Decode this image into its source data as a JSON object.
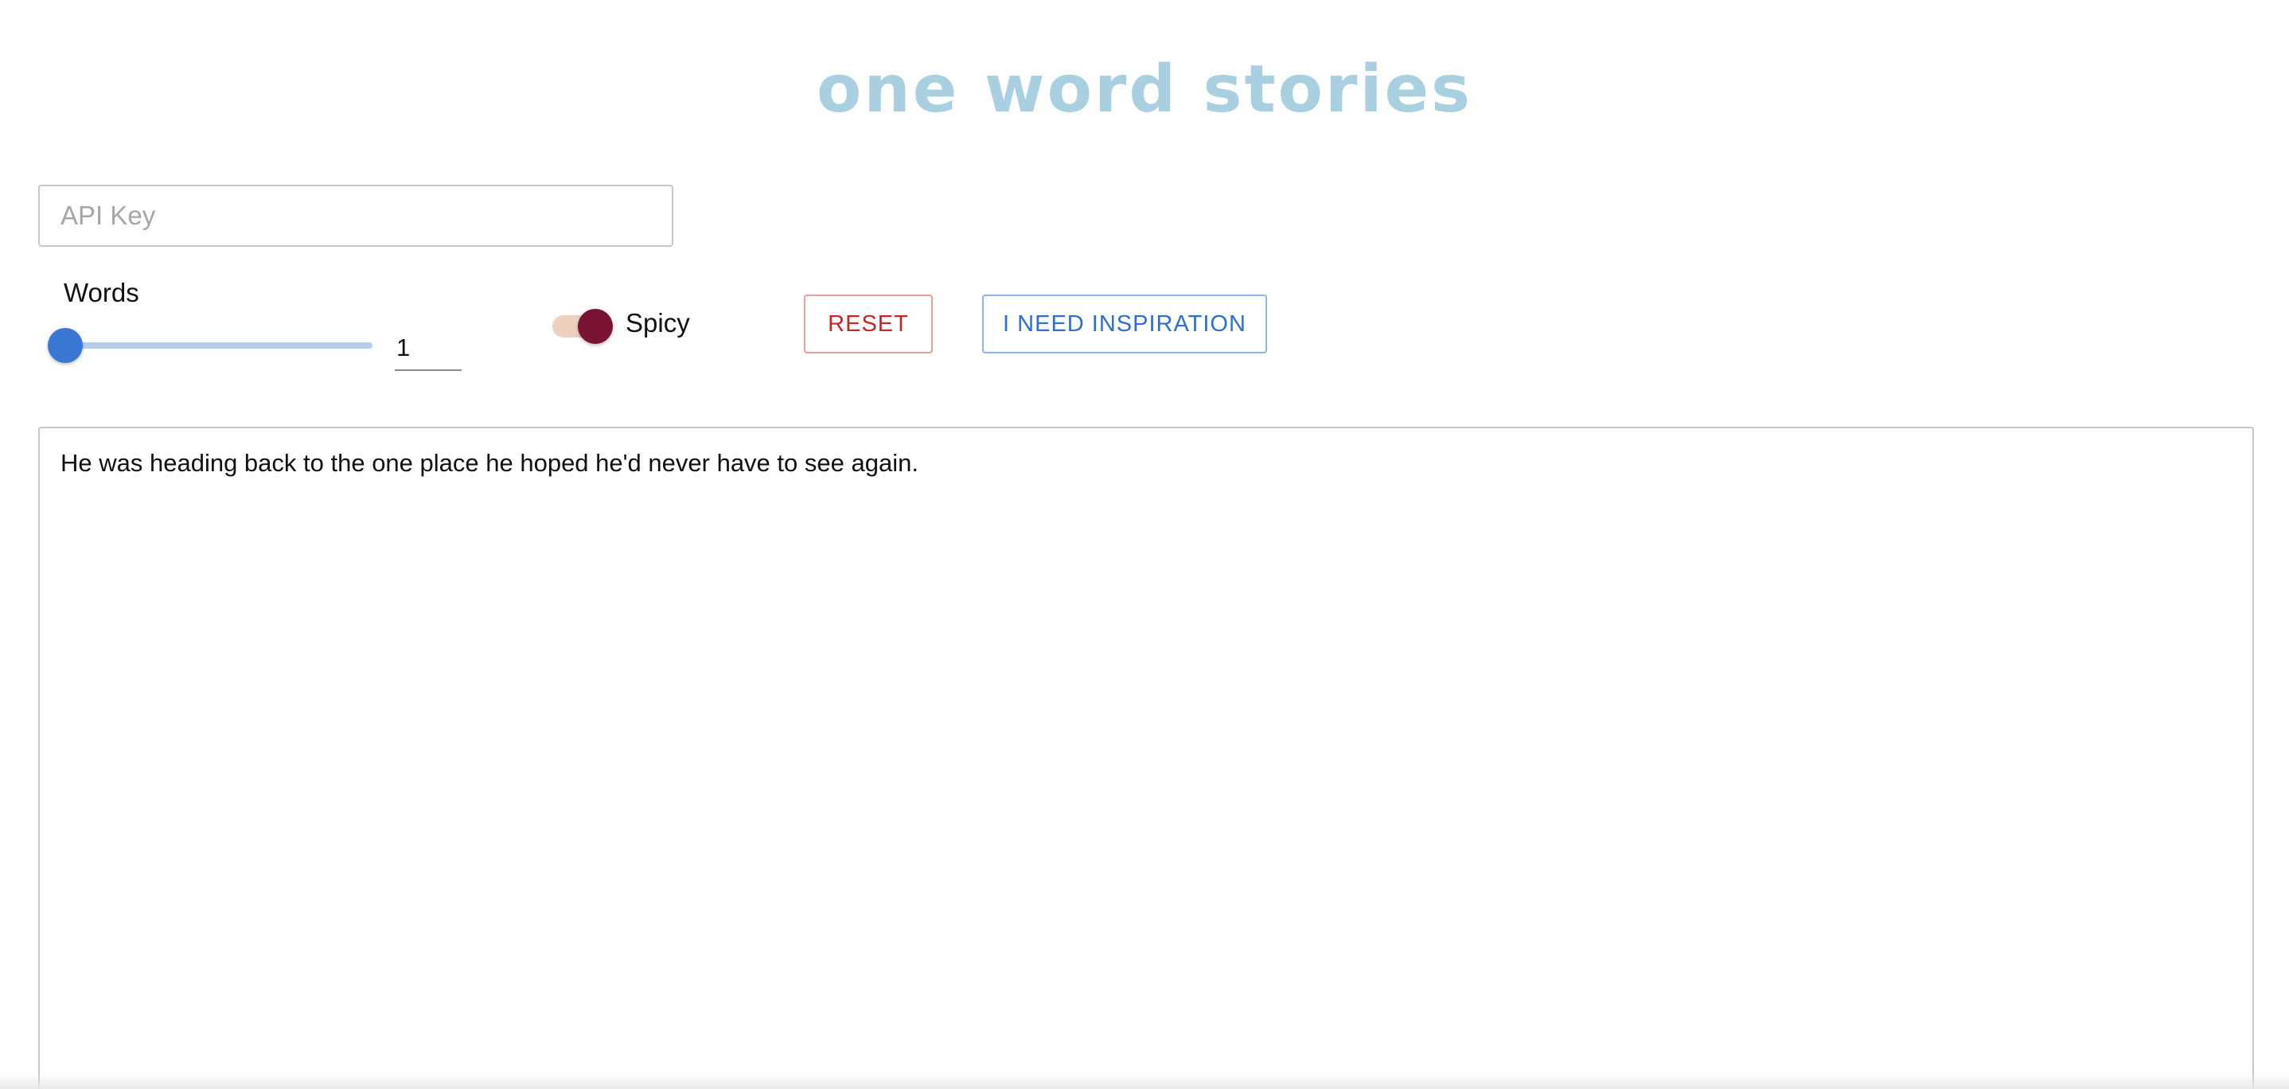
{
  "app": {
    "title": "one word stories"
  },
  "api_key": {
    "placeholder": "API Key",
    "value": ""
  },
  "controls": {
    "words_label": "Words",
    "words_value": "1",
    "words_slider_fraction": 0.0,
    "spicy_label": "Spicy",
    "spicy_on": true,
    "reset_label": "RESET",
    "inspiration_label": "I NEED INSPIRATION"
  },
  "story": {
    "text": "He was heading back to the one place he hoped he'd never have to see again."
  },
  "colors": {
    "title": "#a9d0e0",
    "slider_accent": "#3a78d4",
    "switch_thumb": "#7a1233",
    "switch_track": "#efcfbd",
    "reset": "#c62828",
    "inspiration": "#2f6fd1"
  }
}
